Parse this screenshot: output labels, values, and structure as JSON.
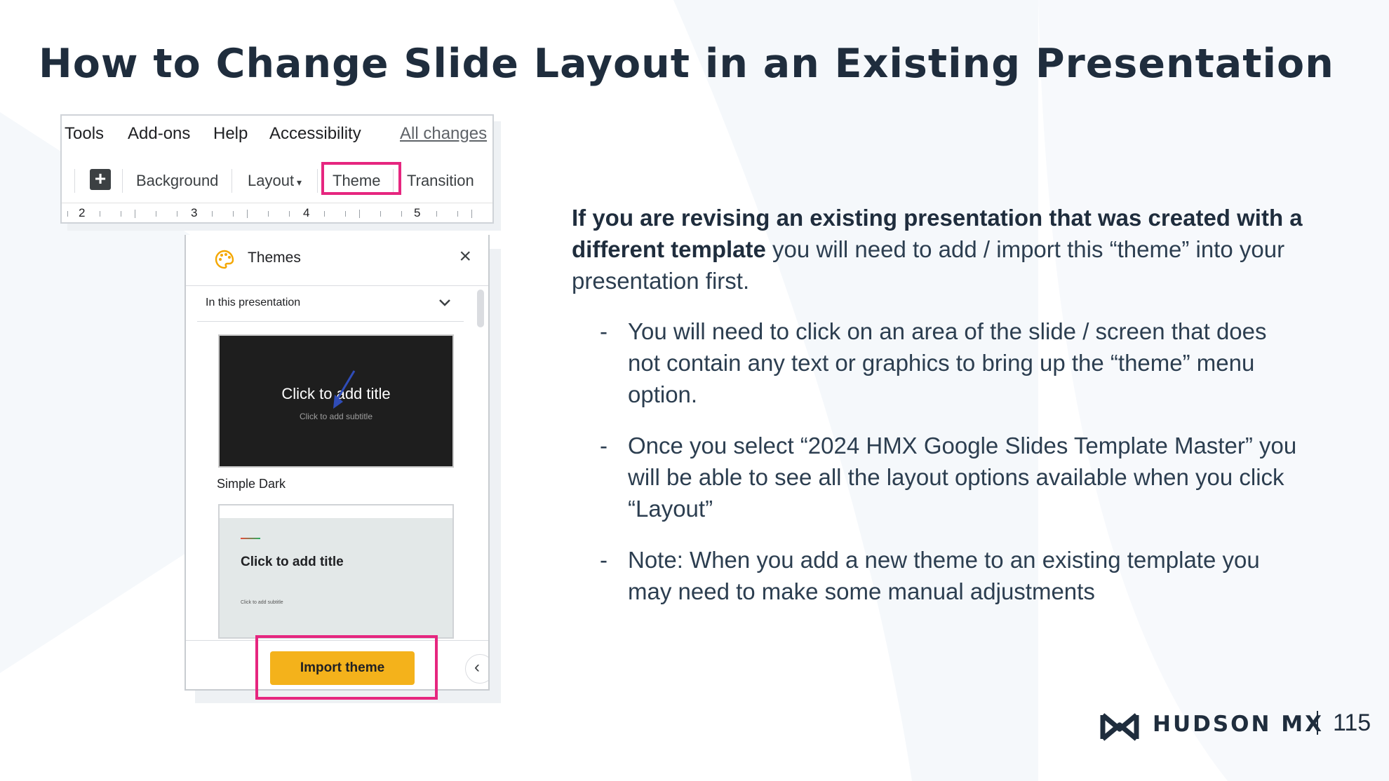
{
  "slide": {
    "title": "How to Change Slide Layout in an Existing Presentation",
    "page_number": "115",
    "brand": "HUDSON MX"
  },
  "menu": {
    "items": [
      "Tools",
      "Add-ons",
      "Help",
      "Accessibility"
    ],
    "all_changes": "All changes"
  },
  "toolbar": {
    "background": "Background",
    "layout": "Layout",
    "theme": "Theme",
    "transition": "Transition"
  },
  "ruler": {
    "numbers": [
      "2",
      "3",
      "4",
      "5"
    ]
  },
  "themes_panel": {
    "title": "Themes",
    "dropdown": "In this presentation",
    "dark_preview_title": "Click to add title",
    "dark_preview_subtitle": "Click to add subtitle",
    "dark_caption": "Simple Dark",
    "light_preview_title": "Click to add title",
    "light_preview_subtitle": "Click to add subtitle",
    "import_button": "Import theme"
  },
  "content": {
    "intro_bold": "If you are revising an existing presentation that was created with a different template",
    "intro_rest": " you will need to add / import this “theme” into your presentation first.",
    "bullet_marker": "-",
    "bullets": [
      "You will need to click on an area of the slide / screen that does not contain any text or graphics to bring up the “theme” menu option.",
      "Once you select “2024 HMX Google Slides Template Master” you will be able to see all the layout options available when you click “Layout”",
      "Note: When you add a new theme to an existing template you may need to make some manual adjustments"
    ]
  },
  "colors": {
    "highlight": "#e6267f",
    "import_button": "#f4b21b",
    "title_text": "#1f2d3d"
  }
}
